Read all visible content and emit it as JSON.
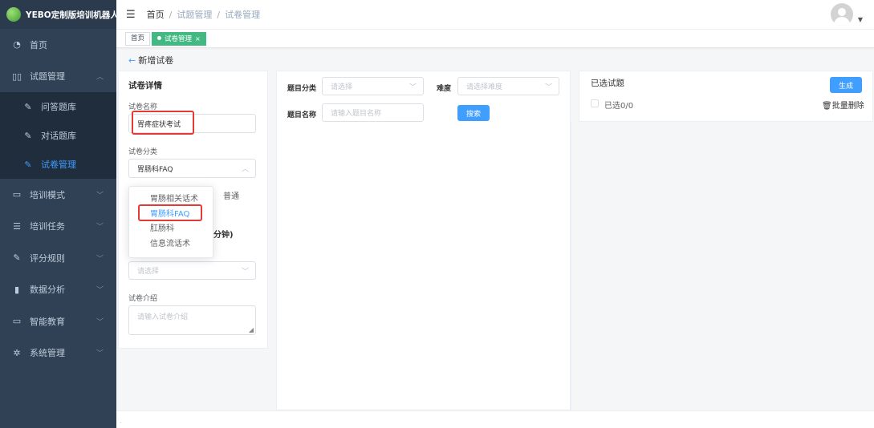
{
  "app": {
    "title": "YEBO定制版培训机器人"
  },
  "sidebar": {
    "items": [
      {
        "label": "首页",
        "icon": "dashboard-icon",
        "glyph": "◔"
      },
      {
        "label": "试题管理",
        "icon": "book-icon",
        "glyph": "▯▯",
        "expanded": true,
        "children": [
          {
            "label": "问答题库",
            "icon": "edit-icon",
            "glyph": "✎"
          },
          {
            "label": "对话题库",
            "icon": "edit-icon",
            "glyph": "✎"
          },
          {
            "label": "试卷管理",
            "icon": "edit-icon",
            "glyph": "✎",
            "active": true
          }
        ]
      },
      {
        "label": "培训模式",
        "icon": "monitor-icon",
        "glyph": "▭"
      },
      {
        "label": "培训任务",
        "icon": "task-list-icon",
        "glyph": "☰"
      },
      {
        "label": "评分规则",
        "icon": "edit-icon",
        "glyph": "✎"
      },
      {
        "label": "数据分析",
        "icon": "bar-chart-icon",
        "glyph": "▮"
      },
      {
        "label": "智能教育",
        "icon": "screen-icon",
        "glyph": "▭"
      },
      {
        "label": "系统管理",
        "icon": "gear-icon",
        "glyph": "✲"
      }
    ]
  },
  "breadcrumb": {
    "home": "首页",
    "level2": "试题管理",
    "level3": "试卷管理"
  },
  "tags": {
    "home": "首页",
    "current": "试卷管理",
    "close": "×"
  },
  "back": {
    "arrow": "←",
    "label": "新增试卷"
  },
  "details": {
    "title": "试卷详情",
    "name_label": "试卷名称",
    "name_value": "胃疼症状考试",
    "category_label": "试卷分类",
    "category_value": "胃肠科FAQ",
    "category_options": [
      "胃肠相关话术",
      "胃肠科FAQ",
      "肛肠科",
      "信息流话术"
    ],
    "radio_partial": "普通",
    "duration_partial": "分钟)",
    "select_placeholder": "请选择",
    "intro_label": "试卷介绍",
    "intro_placeholder": "请输入试卷介绍"
  },
  "filter": {
    "category_label": "题目分类",
    "category_placeholder": "请选择",
    "difficulty_label": "难度",
    "difficulty_placeholder": "请选择难度",
    "name_label": "题目名称",
    "name_placeholder": "请输入题目名称",
    "search_button": "搜索"
  },
  "selected": {
    "title": "已选试题",
    "generate_button": "生成",
    "count_text": "已选0/0",
    "bulk_delete": "批量删除"
  },
  "colors": {
    "primary": "#409eff",
    "sidebar_bg": "#304156",
    "tag_active": "#42b983",
    "highlight": "#e53935"
  }
}
